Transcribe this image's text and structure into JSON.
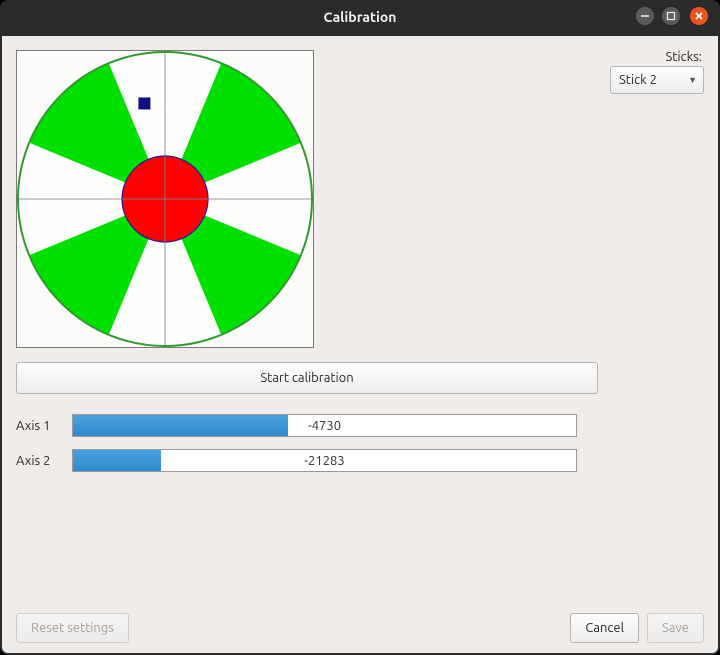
{
  "window": {
    "title": "Calibration"
  },
  "sticks": {
    "label": "Sticks:",
    "selected": "Stick 2"
  },
  "buttons": {
    "start_calibration": "Start calibration",
    "reset_settings": "Reset settings",
    "cancel": "Cancel",
    "save": "Save"
  },
  "axes": [
    {
      "label": "Axis 1",
      "value": -4730,
      "range": [
        -32767,
        32767
      ]
    },
    {
      "label": "Axis 2",
      "value": -21283,
      "range": [
        -32767,
        32767
      ]
    }
  ],
  "stick_visual": {
    "radius_px": 147,
    "deadzone_radius_px": 43,
    "marker": {
      "x_ratio": -0.14,
      "y_ratio": -0.65
    }
  },
  "colors": {
    "wedge": "#00e000",
    "deadzone": "#ff0000",
    "ring": "#2e9a2e",
    "bar_fill": "#3a93d4",
    "titlebar_close": "#e95420"
  }
}
